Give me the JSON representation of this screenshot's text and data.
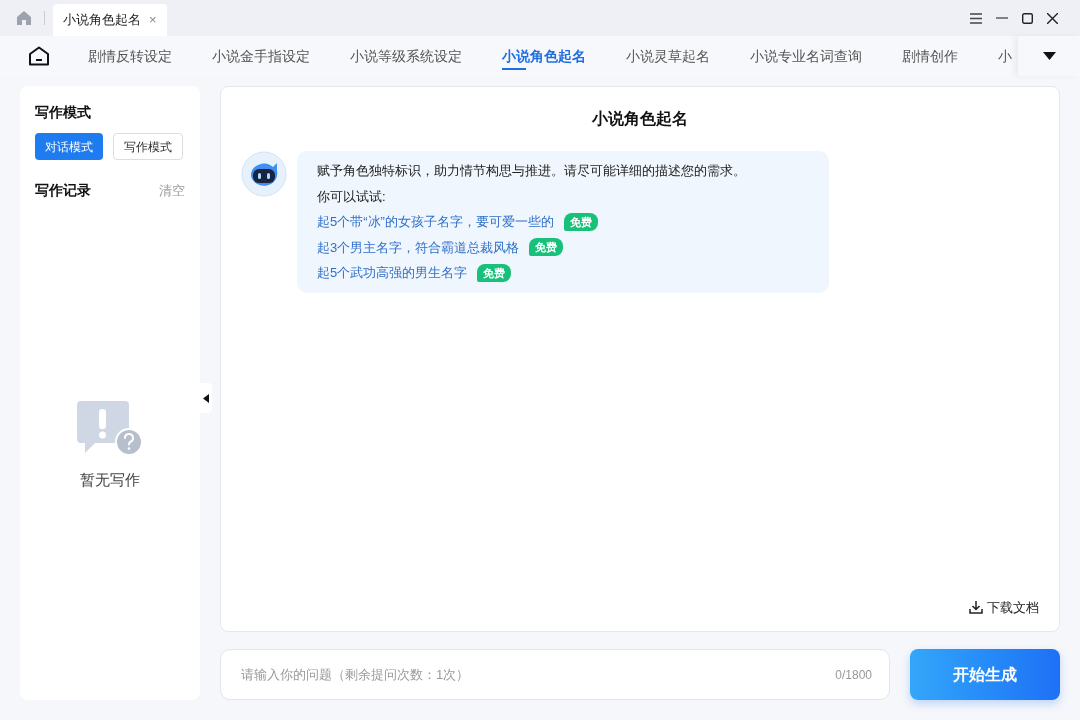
{
  "window": {
    "tab_title": "小说角色起名",
    "close": "×"
  },
  "nav": [
    {
      "label": "剧情反转设定",
      "selected": false
    },
    {
      "label": "小说金手指设定",
      "selected": false
    },
    {
      "label": "小说等级系统设定",
      "selected": false
    },
    {
      "label": "小说角色起名",
      "selected": true
    },
    {
      "label": "小说灵草起名",
      "selected": false
    },
    {
      "label": "小说专业名词查询",
      "selected": false
    },
    {
      "label": "剧情创作",
      "selected": false
    },
    {
      "label": "小",
      "selected": false
    }
  ],
  "sidebar": {
    "mode_title": "写作模式",
    "modes": [
      {
        "label": "对话模式",
        "selected": true
      },
      {
        "label": "写作模式",
        "selected": false
      }
    ],
    "records_title": "写作记录",
    "clear": "清空",
    "empty": "暂无写作"
  },
  "chat": {
    "title": "小说角色起名",
    "intro": "赋予角色独特标识，助力情节构思与推进。请尽可能详细的描述您的需求。",
    "try": "你可以试试:",
    "suggestions": [
      {
        "text": "起5个带“冰”的女孩子名字，要可爱一些的",
        "badge": "免费"
      },
      {
        "text": "起3个男主名字，符合霸道总裁风格",
        "badge": "免费"
      },
      {
        "text": "起5个武功高强的男生名字",
        "badge": "免费"
      }
    ],
    "download": "下载文档"
  },
  "input": {
    "placeholder": "请输入你的问题（剩余提问次数：1次）",
    "count": "0/1800",
    "submit": "开始生成"
  }
}
